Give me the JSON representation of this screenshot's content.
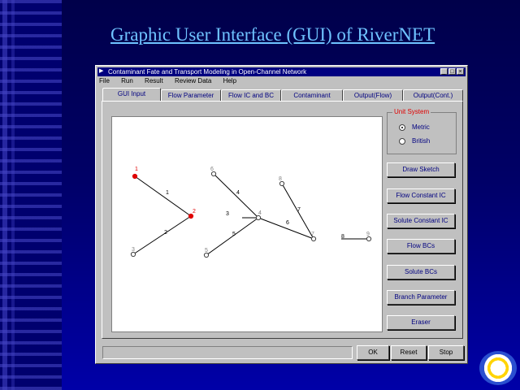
{
  "slide": {
    "title": "Graphic User Interface (GUI) of RiverNET"
  },
  "window": {
    "title": "Contaminant Fate and Transport Modeling in Open-Channel Network",
    "controls": [
      "_",
      "□",
      "×"
    ]
  },
  "menu": [
    "File",
    "Run",
    "Result",
    "Review Data",
    "Help"
  ],
  "tabs": [
    "GUI Input",
    "Flow Parameter",
    "Flow IC and BC",
    "Contaminant",
    "Output(Flow)",
    "Output(Cont.)"
  ],
  "active_tab": "GUI Input",
  "unit_system": {
    "label": "Unit System",
    "options": [
      {
        "label": "Metric",
        "selected": true
      },
      {
        "label": "British",
        "selected": false
      }
    ]
  },
  "side_buttons": [
    "Draw Sketch",
    "Flow Constant IC",
    "Solute Constant IC",
    "Flow BCs",
    "Solute BCs",
    "Branch Parameter",
    "Eraser"
  ],
  "bottom_buttons": {
    "ok": "OK",
    "reset": "Reset",
    "stop": "Stop"
  },
  "network": {
    "nodes": [
      {
        "id": "1",
        "label": "1",
        "color": "#e00000"
      },
      {
        "id": "2",
        "label": "2",
        "color": "#e00000"
      },
      {
        "id": "3",
        "label": "3",
        "color": "#808080"
      },
      {
        "id": "4",
        "label": "4",
        "color": "#808080"
      },
      {
        "id": "5",
        "label": "5",
        "color": "#808080"
      },
      {
        "id": "6",
        "label": "6",
        "color": "#808080"
      },
      {
        "id": "7",
        "label": "7",
        "color": "#808080"
      },
      {
        "id": "8",
        "label": "8",
        "color": "#808080"
      },
      {
        "id": "9",
        "label": "9",
        "color": "#808080"
      }
    ],
    "branch_labels": [
      "1",
      "2",
      "3",
      "4",
      "5",
      "6",
      "7",
      "8"
    ]
  },
  "colors": {
    "slide_bg": "#000066",
    "title_link": "#6fc3ff",
    "titlebar": "#000080",
    "window_face": "#c0c0c0",
    "accent_red": "#e00000"
  }
}
